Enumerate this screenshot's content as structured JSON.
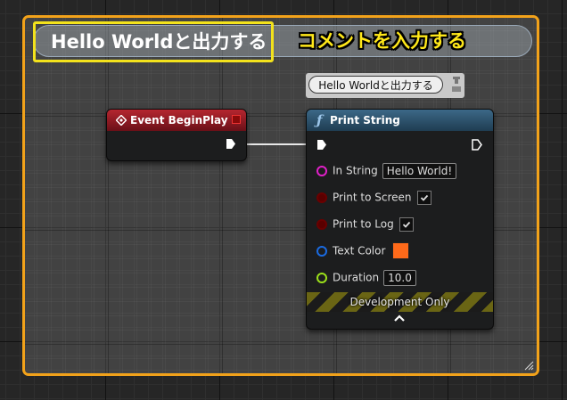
{
  "comment": {
    "title": "Hello Worldと出力する",
    "annotation": "コメントを入力する",
    "border_color": "#f2a21a",
    "highlight_color": "#f3e21c"
  },
  "event_node": {
    "title": "Event BeginPlay",
    "header_color": "#b52630"
  },
  "print_node": {
    "title": "Print String",
    "comment_bubble": "Hello Worldと出力する",
    "header_color": "#3c6887",
    "pins": {
      "in_string": {
        "label": "In String",
        "value": "Hello World!"
      },
      "print_to_screen": {
        "label": "Print to Screen",
        "checked": true
      },
      "print_to_log": {
        "label": "Print to Log",
        "checked": true
      },
      "text_color": {
        "label": "Text Color",
        "value": "#ff6a1a"
      },
      "duration": {
        "label": "Duration",
        "value": "10.0"
      }
    },
    "footer": "Development Only"
  },
  "icons": [
    "event-diamond-icon",
    "function-icon",
    "exec-pin-icon",
    "checkmark-icon",
    "chevron-up-icon",
    "pin-icon",
    "resize-grip-icon"
  ]
}
